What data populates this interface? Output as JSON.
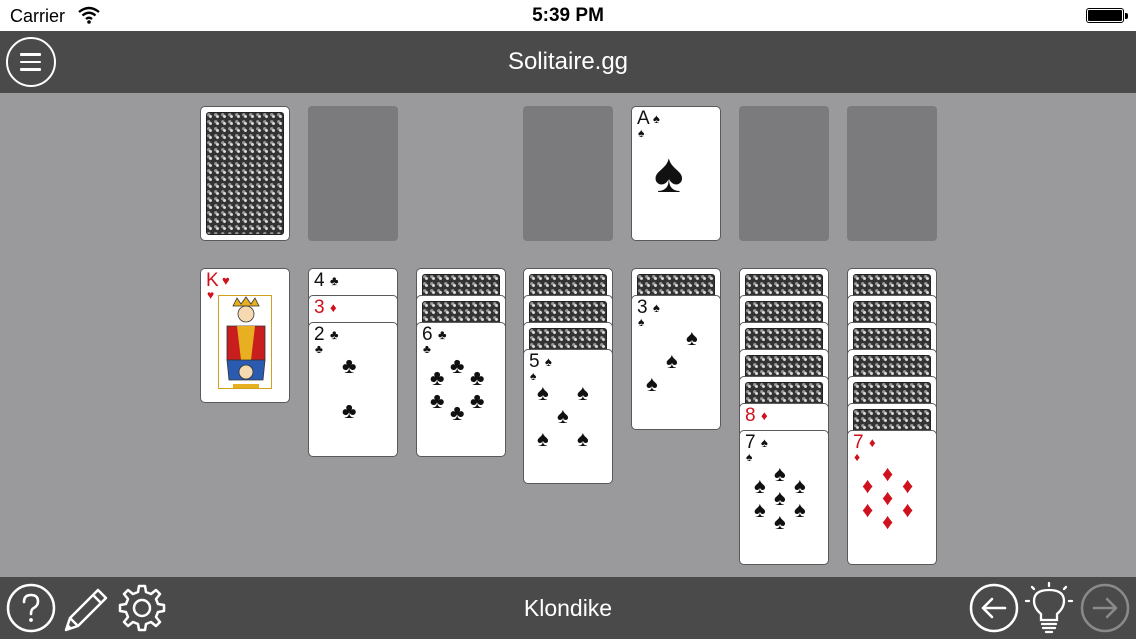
{
  "status_bar": {
    "carrier": "Carrier",
    "time": "5:39 PM"
  },
  "title_bar": {
    "title": "Solitaire.gg"
  },
  "bottom_bar": {
    "mode": "Klondike"
  },
  "icons": {
    "menu": "hamburger-menu-icon",
    "help": "question-mark-icon",
    "edit": "pencil-icon",
    "settings": "gear-icon",
    "undo": "arrow-left-icon",
    "hint": "lightbulb-icon",
    "redo": "arrow-right-icon"
  },
  "colors": {
    "felt": "#9a999b",
    "bar": "#4a4a4b",
    "slot": "#7b7a7c",
    "red_suit": "#d0101c"
  },
  "foundation_top": {
    "rank": "A",
    "suit": "♠"
  },
  "tableau": [
    {
      "face_down": 0,
      "cards": [
        {
          "rank": "K",
          "suit": "♥"
        }
      ]
    },
    {
      "face_down": 0,
      "cards": [
        {
          "rank": "4",
          "suit": "♣"
        },
        {
          "rank": "3",
          "suit": "♦"
        },
        {
          "rank": "2",
          "suit": "♣"
        }
      ]
    },
    {
      "face_down": 2,
      "cards": [
        {
          "rank": "6",
          "suit": "♣"
        }
      ]
    },
    {
      "face_down": 3,
      "cards": [
        {
          "rank": "5",
          "suit": "♠"
        }
      ]
    },
    {
      "face_down": 1,
      "cards": [
        {
          "rank": "3",
          "suit": "♠"
        }
      ]
    },
    {
      "face_down": 5,
      "cards": [
        {
          "rank": "8",
          "suit": "♦"
        },
        {
          "rank": "7",
          "suit": "♠"
        }
      ]
    },
    {
      "face_down": 6,
      "cards": [
        {
          "rank": "7",
          "suit": "♦"
        }
      ]
    }
  ]
}
